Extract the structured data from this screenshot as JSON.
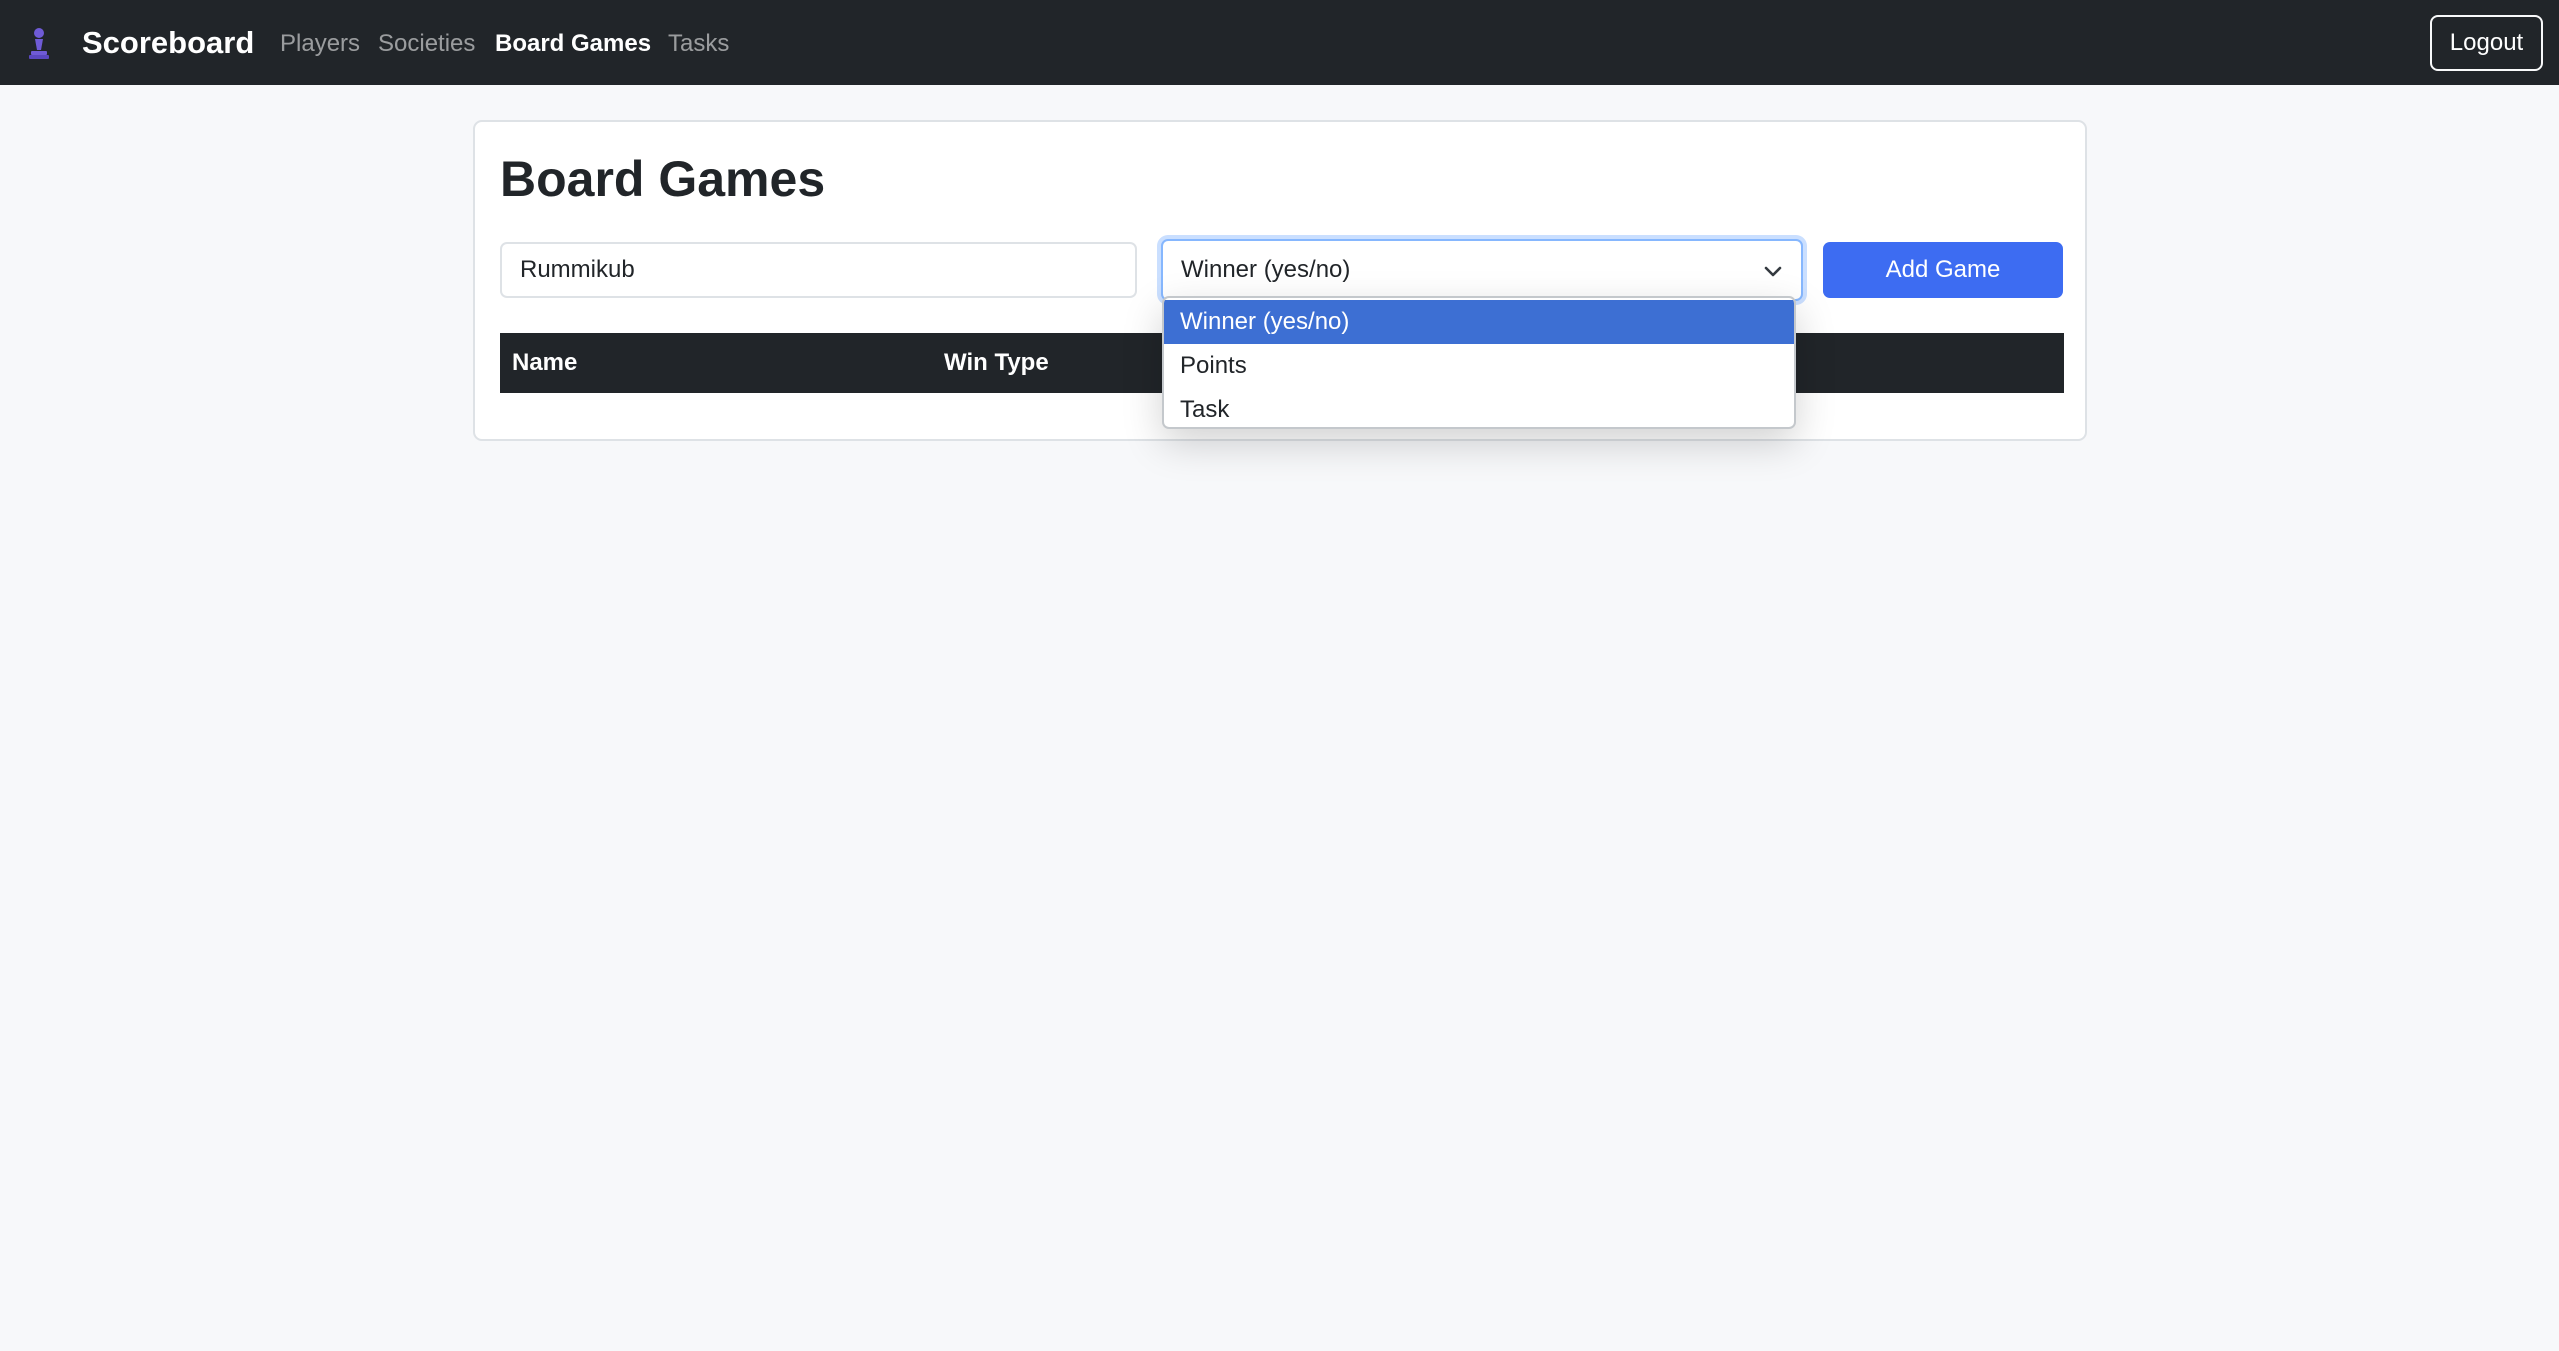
{
  "navbar": {
    "brand": "Scoreboard",
    "brand_icon": "chess-pawn-icon",
    "links": [
      {
        "label": "Players",
        "active": false
      },
      {
        "label": "Societies",
        "active": false
      },
      {
        "label": "Board Games",
        "active": true
      },
      {
        "label": "Tasks",
        "active": false
      }
    ],
    "logout_label": "Logout"
  },
  "main": {
    "title": "Board Games",
    "form": {
      "name_value": "Rummikub",
      "win_type": {
        "selected": "Winner (yes/no)",
        "options": [
          "Winner (yes/no)",
          "Points",
          "Task"
        ],
        "open": true
      },
      "add_button_label": "Add Game"
    },
    "table": {
      "columns": [
        "Name",
        "Win Type"
      ]
    }
  },
  "colors": {
    "navbar_bg": "#212529",
    "accent": "#3d6cf2",
    "option_highlight": "#3d6fd3",
    "page_bg": "#f7f8fa"
  }
}
